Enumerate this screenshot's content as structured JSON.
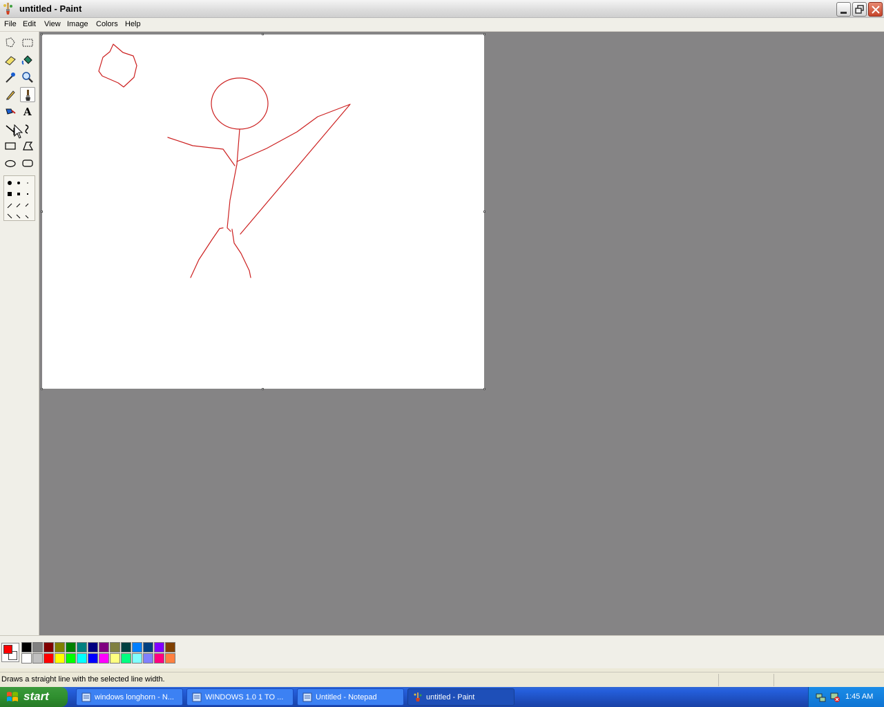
{
  "window": {
    "title": "untitled - Paint",
    "menu": [
      "File",
      "Edit",
      "View",
      "Image",
      "Colors",
      "Help"
    ]
  },
  "toolbox": {
    "tools": [
      {
        "name": "free-form-select-icon",
        "selected": false
      },
      {
        "name": "select-icon",
        "selected": false
      },
      {
        "name": "eraser-icon",
        "selected": false
      },
      {
        "name": "fill-with-color-icon",
        "selected": false
      },
      {
        "name": "pick-color-icon",
        "selected": false
      },
      {
        "name": "magnifier-icon",
        "selected": false
      },
      {
        "name": "pencil-icon",
        "selected": false
      },
      {
        "name": "brush-icon",
        "selected": true
      },
      {
        "name": "airbrush-icon",
        "selected": false
      },
      {
        "name": "text-icon",
        "selected": false,
        "glyph": "A"
      },
      {
        "name": "line-icon",
        "selected": false
      },
      {
        "name": "curve-icon",
        "selected": false
      },
      {
        "name": "rectangle-icon",
        "selected": false
      },
      {
        "name": "polygon-icon",
        "selected": false
      },
      {
        "name": "ellipse-icon",
        "selected": false
      },
      {
        "name": "rounded-rectangle-icon",
        "selected": false
      }
    ]
  },
  "canvas": {
    "stroke_color": "#cc1f1f",
    "background": "#ffffff"
  },
  "palette": {
    "foreground": "#ff0000",
    "background": "#ffffff",
    "row1": [
      "#000000",
      "#808080",
      "#800000",
      "#808000",
      "#008000",
      "#008080",
      "#000080",
      "#800080",
      "#808040",
      "#004040",
      "#0080ff",
      "#004080",
      "#8000ff",
      "#804000"
    ],
    "row2": [
      "#ffffff",
      "#c0c0c0",
      "#ff0000",
      "#ffff00",
      "#00ff00",
      "#00ffff",
      "#0000ff",
      "#ff00ff",
      "#ffff80",
      "#00ff80",
      "#80ffff",
      "#8080ff",
      "#ff0080",
      "#ff8040"
    ]
  },
  "status": {
    "text": "Draws a straight line with the selected line width."
  },
  "taskbar": {
    "start_label": "start",
    "items": [
      {
        "label": "windows longhorn - N...",
        "active": false
      },
      {
        "label": "WINDOWS 1.0 1 TO ...",
        "active": false
      },
      {
        "label": "Untitled - Notepad",
        "active": false
      },
      {
        "label": "untitled - Paint",
        "active": true
      }
    ],
    "clock": "1:45 AM"
  }
}
